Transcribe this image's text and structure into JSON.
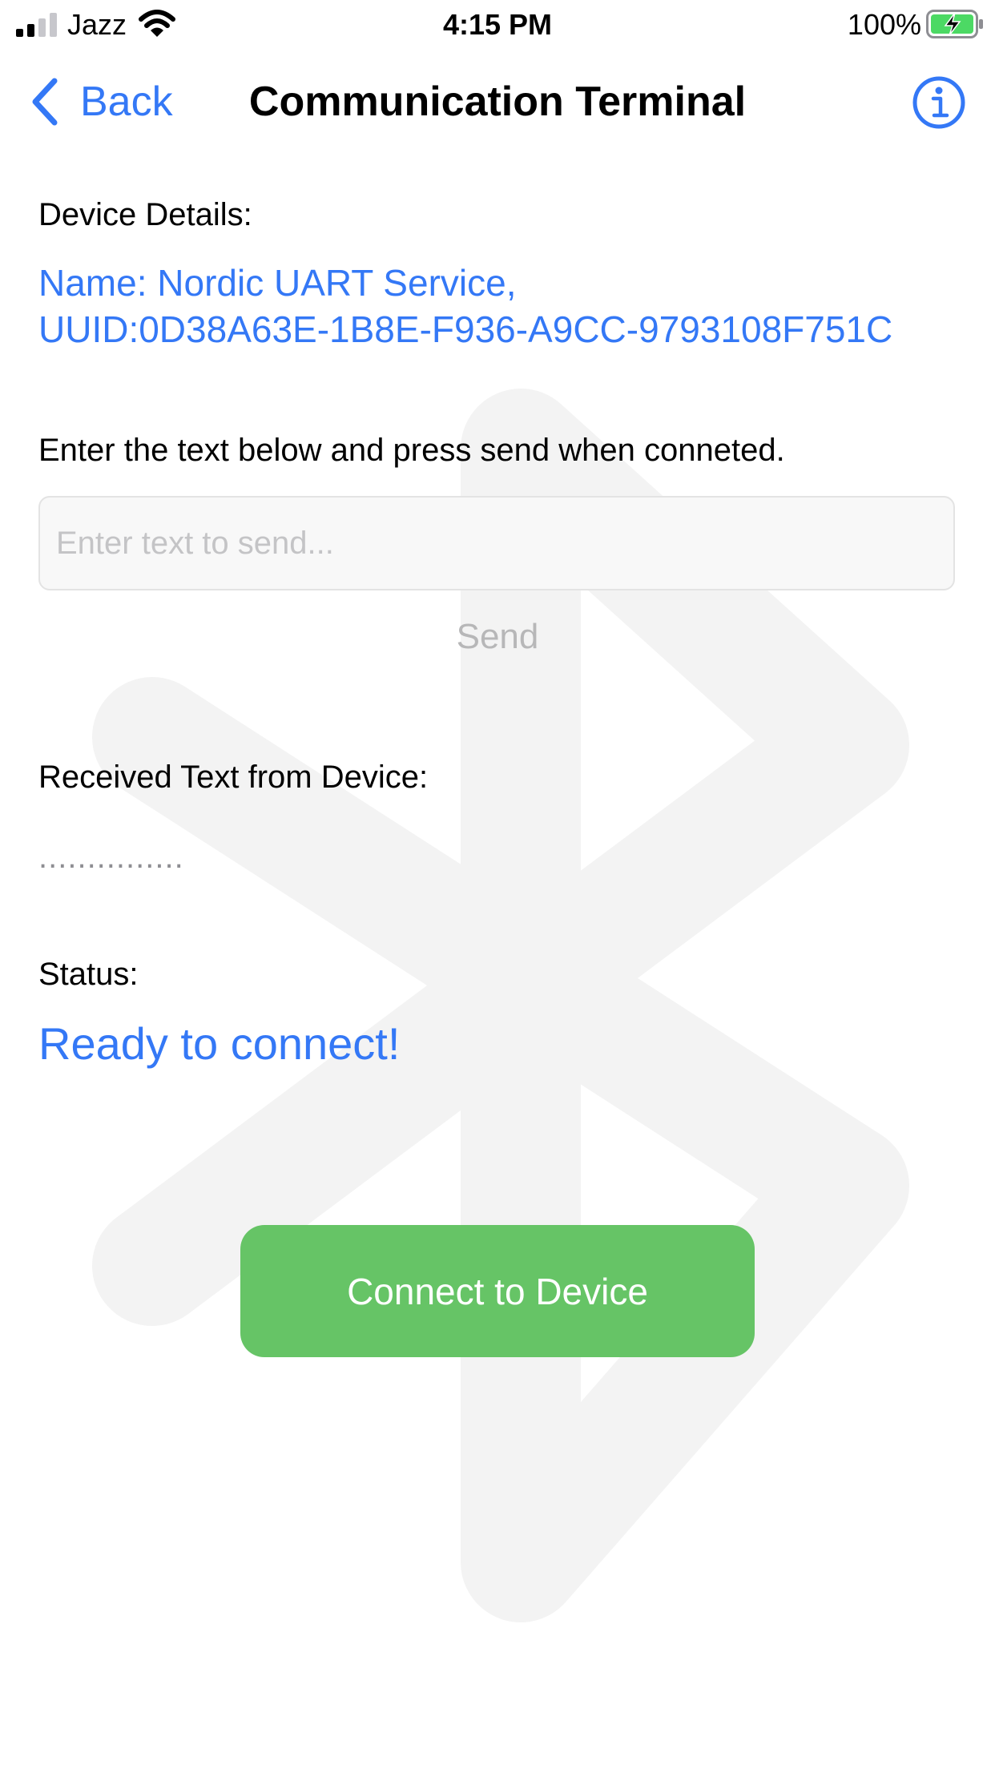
{
  "status_bar": {
    "carrier": "Jazz",
    "time": "4:15 PM",
    "battery_percent": "100%",
    "battery_color": "#4cd964",
    "icons": [
      "signal-icon",
      "wifi-icon",
      "battery-charging-icon"
    ]
  },
  "nav": {
    "back_label": "Back",
    "title": "Communication Terminal",
    "accent_color": "#3478f6",
    "icons": [
      "chevron-left-icon",
      "info-icon"
    ]
  },
  "device": {
    "label": "Device Details:",
    "name_line": "Name: Nordic UART Service,",
    "uuid_line": "UUID:0D38A63E-1B8E-F936-A9CC-9793108F751C"
  },
  "send": {
    "prompt": "Enter the text below and press send when conneted.",
    "input_value": "",
    "input_placeholder": "Enter text to send...",
    "button_label": "Send"
  },
  "received": {
    "label": "Received Text from Device:",
    "text": "..............."
  },
  "status": {
    "label": "Status:",
    "value": "Ready to connect!"
  },
  "connect": {
    "button_label": "Connect to Device",
    "button_color": "#66c466"
  },
  "background": {
    "watermark_icon": "bluetooth-icon"
  }
}
